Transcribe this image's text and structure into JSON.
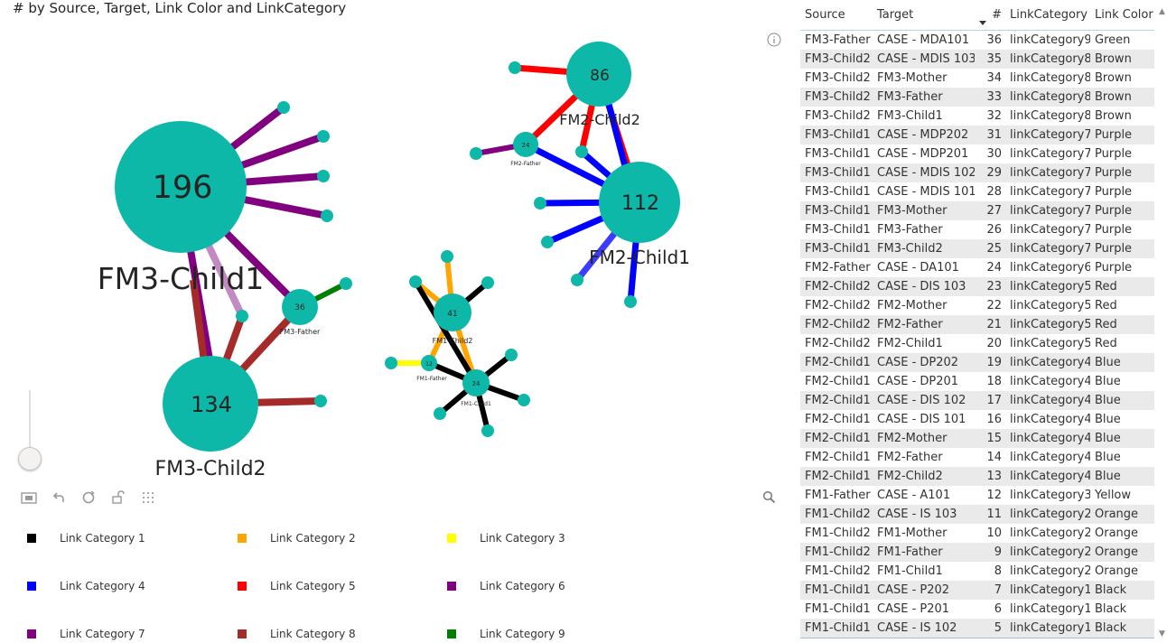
{
  "visual": {
    "title": "# by Source, Target, Link Color and LinkCategory"
  },
  "graph": {
    "hubs": [
      {
        "value": "196",
        "label": "FM3-Child1"
      },
      {
        "value": "134",
        "label": "FM3-Child2"
      },
      {
        "value": "112",
        "label": "FM2-Child1"
      },
      {
        "value": "86",
        "label": "FM2-Child2"
      },
      {
        "value": "36",
        "label": "FM3-Father"
      },
      {
        "value": "41",
        "label": "FM1-Child2"
      },
      {
        "value": "24",
        "label": "FM2-Father"
      },
      {
        "value": "24",
        "label": "FM1-Child1"
      },
      {
        "value": "12",
        "label": "FM1-Father"
      }
    ]
  },
  "toolbar": {
    "icons": [
      "fit-screen-icon",
      "undo-icon",
      "refresh-icon",
      "unlock-icon",
      "grid-icon"
    ]
  },
  "legend": [
    {
      "label": "Link Category 1",
      "color": "#000000"
    },
    {
      "label": "Link Category 2",
      "color": "#ffa500"
    },
    {
      "label": "Link Category 3",
      "color": "#ffff00"
    },
    {
      "label": "Link Category 4",
      "color": "#0000ff"
    },
    {
      "label": "Link Category 5",
      "color": "#ff0000"
    },
    {
      "label": "Link Category 6",
      "color": "#800080"
    },
    {
      "label": "Link Category 7",
      "color": "#800080"
    },
    {
      "label": "Link Category 8",
      "color": "#a52a2a"
    },
    {
      "label": "Link Category 9",
      "color": "#008000"
    }
  ],
  "table": {
    "columns": [
      "Source",
      "Target",
      "#",
      "LinkCategory",
      "Link Color"
    ],
    "sort_column": "#",
    "rows": [
      [
        "FM3-Father",
        "CASE - MDA101",
        "36",
        "linkCategory9",
        "Green"
      ],
      [
        "FM3-Child2",
        "CASE - MDIS 103",
        "35",
        "linkCategory8",
        "Brown"
      ],
      [
        "FM3-Child2",
        "FM3-Mother",
        "34",
        "linkCategory8",
        "Brown"
      ],
      [
        "FM3-Child2",
        "FM3-Father",
        "33",
        "linkCategory8",
        "Brown"
      ],
      [
        "FM3-Child2",
        "FM3-Child1",
        "32",
        "linkCategory8",
        "Brown"
      ],
      [
        "FM3-Child1",
        "CASE - MDP202",
        "31",
        "linkCategory7",
        "Purple"
      ],
      [
        "FM3-Child1",
        "CASE - MDP201",
        "30",
        "linkCategory7",
        "Purple"
      ],
      [
        "FM3-Child1",
        "CASE - MDIS 102",
        "29",
        "linkCategory7",
        "Purple"
      ],
      [
        "FM3-Child1",
        "CASE - MDIS 101",
        "28",
        "linkCategory7",
        "Purple"
      ],
      [
        "FM3-Child1",
        "FM3-Mother",
        "27",
        "linkCategory7",
        "Purple"
      ],
      [
        "FM3-Child1",
        "FM3-Father",
        "26",
        "linkCategory7",
        "Purple"
      ],
      [
        "FM3-Child1",
        "FM3-Child2",
        "25",
        "linkCategory7",
        "Purple"
      ],
      [
        "FM2-Father",
        "CASE - DA101",
        "24",
        "linkCategory6",
        "Purple"
      ],
      [
        "FM2-Child2",
        "CASE - DIS 103",
        "23",
        "linkCategory5",
        "Red"
      ],
      [
        "FM2-Child2",
        "FM2-Mother",
        "22",
        "linkCategory5",
        "Red"
      ],
      [
        "FM2-Child2",
        "FM2-Father",
        "21",
        "linkCategory5",
        "Red"
      ],
      [
        "FM2-Child2",
        "FM2-Child1",
        "20",
        "linkCategory5",
        "Red"
      ],
      [
        "FM2-Child1",
        "CASE - DP202",
        "19",
        "linkCategory4",
        "Blue"
      ],
      [
        "FM2-Child1",
        "CASE - DP201",
        "18",
        "linkCategory4",
        "Blue"
      ],
      [
        "FM2-Child1",
        "CASE - DIS 102",
        "17",
        "linkCategory4",
        "Blue"
      ],
      [
        "FM2-Child1",
        "CASE - DIS 101",
        "16",
        "linkCategory4",
        "Blue"
      ],
      [
        "FM2-Child1",
        "FM2-Mother",
        "15",
        "linkCategory4",
        "Blue"
      ],
      [
        "FM2-Child1",
        "FM2-Father",
        "14",
        "linkCategory4",
        "Blue"
      ],
      [
        "FM2-Child1",
        "FM2-Child2",
        "13",
        "linkCategory4",
        "Blue"
      ],
      [
        "FM1-Father",
        "CASE - A101",
        "12",
        "linkCategory3",
        "Yellow"
      ],
      [
        "FM1-Child2",
        "CASE - IS 103",
        "11",
        "linkCategory2",
        "Orange"
      ],
      [
        "FM1-Child2",
        "FM1-Mother",
        "10",
        "linkCategory2",
        "Orange"
      ],
      [
        "FM1-Child2",
        "FM1-Father",
        "9",
        "linkCategory2",
        "Orange"
      ],
      [
        "FM1-Child2",
        "FM1-Child1",
        "8",
        "linkCategory2",
        "Orange"
      ],
      [
        "FM1-Child1",
        "CASE - P202",
        "7",
        "linkCategory1",
        "Black"
      ],
      [
        "FM1-Child1",
        "CASE - P201",
        "6",
        "linkCategory1",
        "Black"
      ],
      [
        "FM1-Child1",
        "CASE - IS 102",
        "5",
        "linkCategory1",
        "Black"
      ]
    ]
  },
  "colors": {
    "node": "#0eb8a8",
    "table_stripe": "#eaeaea",
    "header_border": "#bcd3e6"
  }
}
